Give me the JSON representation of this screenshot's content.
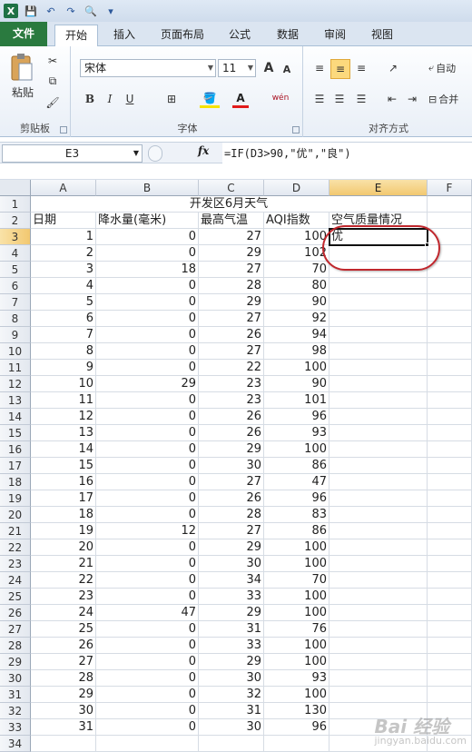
{
  "qat": {
    "logo": "X",
    "save": "💾",
    "undo": "↶",
    "redo": "↷",
    "preview": "🔍",
    "more": "▾"
  },
  "tabs": [
    "文件",
    "开始",
    "插入",
    "页面布局",
    "公式",
    "数据",
    "审阅",
    "视图"
  ],
  "ribbon": {
    "clipboard": {
      "paste": "粘贴",
      "label": "剪贴板"
    },
    "font": {
      "name": "宋体",
      "size": "11",
      "grow": "A",
      "shrink": "A",
      "bold": "B",
      "italic": "I",
      "underline": "U",
      "color_a": "A",
      "phonetic": "wén",
      "label": "字体"
    },
    "align": {
      "wrap": "自动",
      "merge": "合并",
      "label": "对齐方式"
    }
  },
  "formula_bar": {
    "namebox": "E3",
    "fx": "fx",
    "formula": "=IF(D3>90,\"优\",\"良\")"
  },
  "columns": [
    "A",
    "B",
    "C",
    "D",
    "E",
    "F"
  ],
  "title": "开发区6月天气",
  "headers": [
    "日期",
    "降水量(毫米)",
    "最高气温",
    "AQI指数",
    "空气质量情况"
  ],
  "active_value": "优",
  "rows": [
    [
      1,
      0,
      27,
      100
    ],
    [
      2,
      0,
      29,
      102
    ],
    [
      3,
      18,
      27,
      70
    ],
    [
      4,
      0,
      28,
      80
    ],
    [
      5,
      0,
      29,
      90
    ],
    [
      6,
      0,
      27,
      92
    ],
    [
      7,
      0,
      26,
      94
    ],
    [
      8,
      0,
      27,
      98
    ],
    [
      9,
      0,
      22,
      100
    ],
    [
      10,
      29,
      23,
      90
    ],
    [
      11,
      0,
      23,
      101
    ],
    [
      12,
      0,
      26,
      96
    ],
    [
      13,
      0,
      26,
      93
    ],
    [
      14,
      0,
      29,
      100
    ],
    [
      15,
      0,
      30,
      86
    ],
    [
      16,
      0,
      27,
      47
    ],
    [
      17,
      0,
      26,
      96
    ],
    [
      18,
      0,
      28,
      83
    ],
    [
      19,
      12,
      27,
      86
    ],
    [
      20,
      0,
      29,
      100
    ],
    [
      21,
      0,
      30,
      100
    ],
    [
      22,
      0,
      34,
      70
    ],
    [
      23,
      0,
      33,
      100
    ],
    [
      24,
      47,
      29,
      100
    ],
    [
      25,
      0,
      31,
      76
    ],
    [
      26,
      0,
      33,
      100
    ],
    [
      27,
      0,
      29,
      100
    ],
    [
      28,
      0,
      30,
      93
    ],
    [
      29,
      0,
      32,
      100
    ],
    [
      30,
      0,
      31,
      130
    ],
    [
      31,
      0,
      30,
      96
    ]
  ],
  "row_numbers": [
    "1",
    "2",
    "3",
    "4",
    "5",
    "6",
    "7",
    "8",
    "9",
    "10",
    "11",
    "12",
    "13",
    "14",
    "15",
    "16",
    "17",
    "18",
    "19",
    "20",
    "21",
    "22",
    "23",
    "24",
    "25",
    "26",
    "27",
    "28",
    "29",
    "30",
    "31",
    "32",
    "33",
    "34"
  ],
  "watermark": {
    "brand": "Bai 经验",
    "url": "jingyan.baidu.com"
  }
}
